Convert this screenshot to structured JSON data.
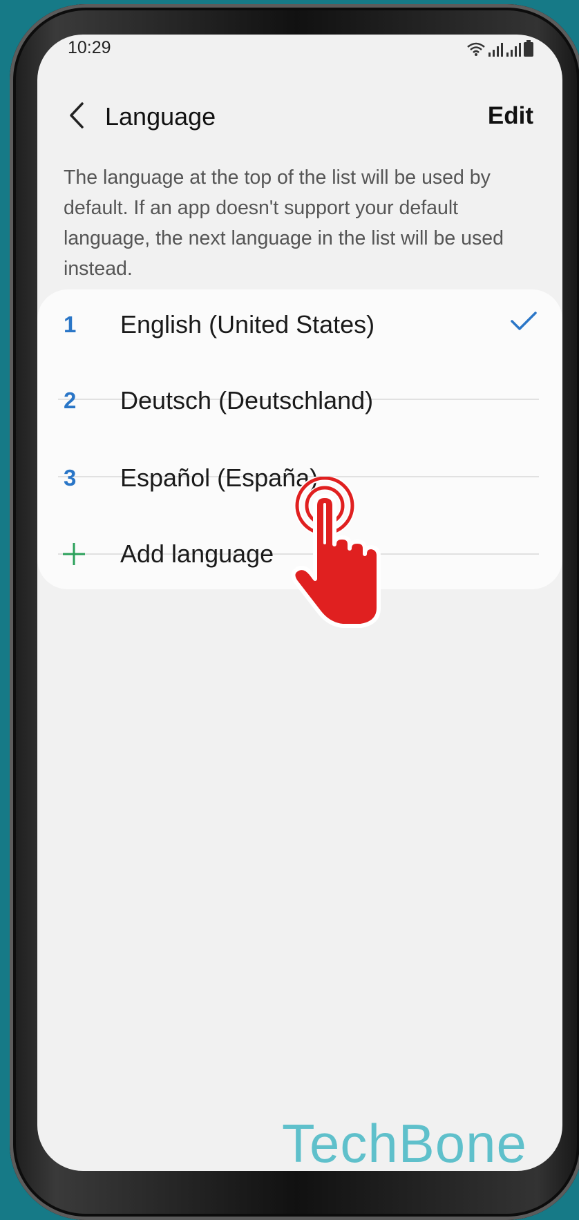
{
  "status_bar": {
    "time": "10:29",
    "icons": [
      "wifi-icon",
      "signal-icon",
      "signal-icon",
      "battery-icon"
    ]
  },
  "app_bar": {
    "title": "Language",
    "back_icon": "chevron-left-icon",
    "edit_label": "Edit"
  },
  "description": "The language at the top of the list will be used by default. If an app doesn't support your default language, the next language in the list will be used instead.",
  "languages": [
    {
      "number": "1",
      "label": "English (United States)",
      "selected": true
    },
    {
      "number": "2",
      "label": "Deutsch (Deutschland)",
      "selected": false
    },
    {
      "number": "3",
      "label": "Español (España)",
      "selected": false
    }
  ],
  "add_language": {
    "label": "Add language",
    "icon": "plus-icon"
  },
  "overlay": {
    "icon": "tap-hand-icon"
  },
  "watermark": "TechBone",
  "colors": {
    "background": "#167a87",
    "screen": "#f1f1f1",
    "accent_blue": "#2a76c7",
    "plus_green": "#2aa05a",
    "tap_red": "#e02020",
    "watermark": "#5fc0cb"
  }
}
